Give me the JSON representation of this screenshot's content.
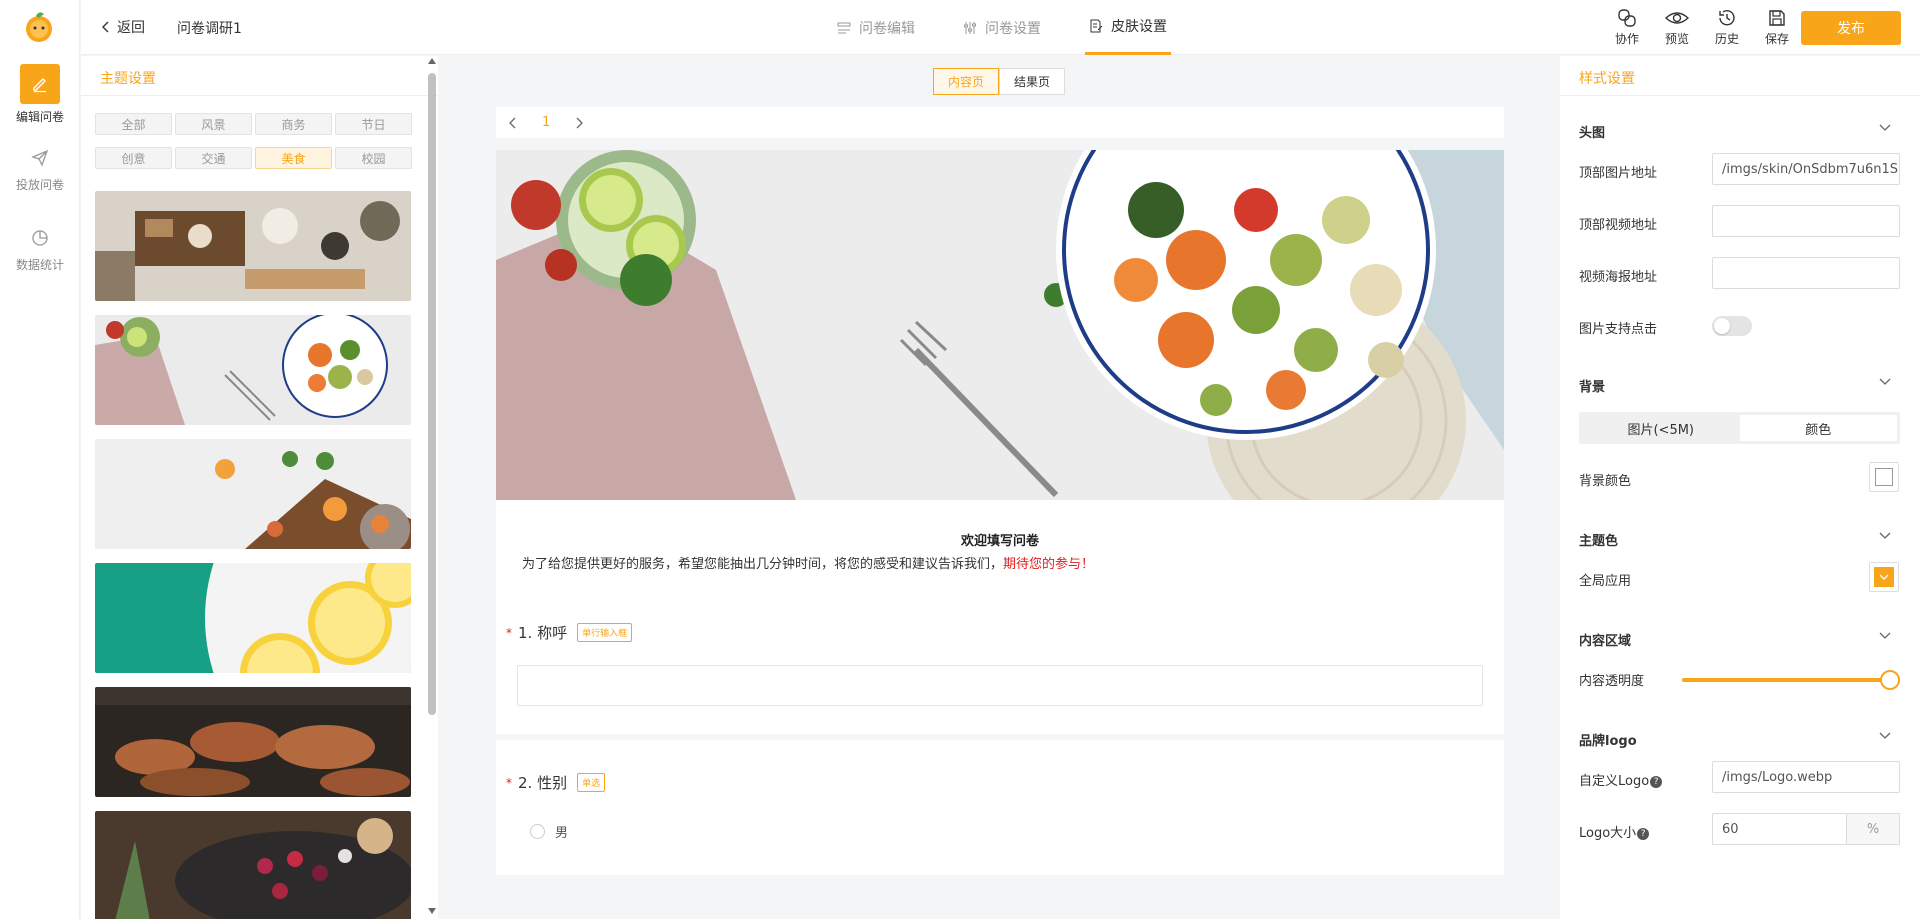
{
  "nav": {
    "items": [
      {
        "label": "编辑问卷",
        "icon": "edit-icon"
      },
      {
        "label": "投放问卷",
        "icon": "send-icon"
      },
      {
        "label": "数据统计",
        "icon": "chart-pie-icon"
      }
    ]
  },
  "topbar": {
    "back": "返回",
    "title": "问卷调研1",
    "tabs": [
      {
        "label": "问卷编辑",
        "icon": "list-icon"
      },
      {
        "label": "问卷设置",
        "icon": "sliders-icon"
      },
      {
        "label": "皮肤设置",
        "icon": "document-edit-icon"
      }
    ],
    "tools": [
      {
        "label": "协作",
        "icon": "link-icon"
      },
      {
        "label": "预览",
        "icon": "eye-icon"
      },
      {
        "label": "历史",
        "icon": "clock-icon"
      },
      {
        "label": "保存",
        "icon": "save-icon"
      }
    ],
    "publish": "发布"
  },
  "theme": {
    "title": "主题设置",
    "categories": [
      "全部",
      "风景",
      "商务",
      "节日",
      "创意",
      "交通",
      "美食",
      "校园"
    ],
    "active_category": "美食"
  },
  "canvas": {
    "toggle": [
      "内容页",
      "结果页"
    ],
    "page": "1",
    "welcome": "欢迎填写问卷",
    "desc": "为了给您提供更好的服务，希望您能抽出几分钟时间，将您的感受和建议告诉我们，",
    "desc_highlight": "期待您的参与！",
    "q1": {
      "star": "*",
      "title": "1. 称呼",
      "tag": "单行输入框"
    },
    "q2": {
      "star": "*",
      "title": "2. 性别",
      "tag": "单选"
    },
    "option1": "男"
  },
  "style": {
    "title": "样式设置",
    "sec_head": "头图",
    "top_img_label": "顶部图片地址",
    "top_img_value": "/imgs/skin/OnSdbm7u6n1S",
    "top_video_label": "顶部视频地址",
    "poster_label": "视频海报地址",
    "img_click_label": "图片支持点击",
    "sec_bg": "背景",
    "seg": [
      "图片(<5M)",
      "颜色"
    ],
    "bg_color_label": "背景颜色",
    "sec_theme": "主题色",
    "global_label": "全局应用",
    "sec_content": "内容区域",
    "opacity_label": "内容透明度",
    "opacity_value": 1.0,
    "sec_logo": "品牌logo",
    "custom_logo_label": "自定义Logo",
    "custom_logo_value": "/imgs/Logo.webp",
    "logo_size_label": "Logo大小",
    "logo_size_value": "60",
    "logo_size_unit": "%",
    "accent": "#f9a51a"
  }
}
